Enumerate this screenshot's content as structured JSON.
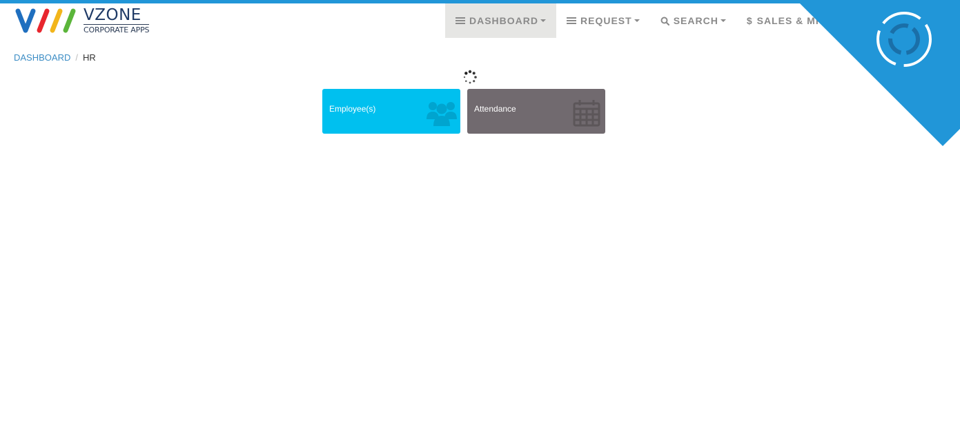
{
  "brand": {
    "title": "VZONE",
    "subtitle": "CORPORATE APPS",
    "colors": [
      "#1f6fbf",
      "#e8262e",
      "#f2b51b",
      "#5bb53a"
    ]
  },
  "nav": {
    "items": [
      {
        "label": "DASHBOARD",
        "icon": "list-icon",
        "active": true
      },
      {
        "label": "REQUEST",
        "icon": "list-icon",
        "active": false
      },
      {
        "label": "SEARCH",
        "icon": "search-icon",
        "active": false
      },
      {
        "label": "SALES & MRI",
        "icon": "dollar-icon",
        "active": false
      }
    ],
    "accent": "#2196d8"
  },
  "breadcrumb": {
    "home": "DASHBOARD",
    "separator": "/",
    "current": "HR"
  },
  "tiles": [
    {
      "label": "Employee(s)",
      "icon": "users-icon",
      "color": "#00c0ef"
    },
    {
      "label": "Attendance",
      "icon": "calendar-icon",
      "color": "#716a6f"
    }
  ],
  "loading": {
    "icon": "loading-spinner-icon"
  }
}
